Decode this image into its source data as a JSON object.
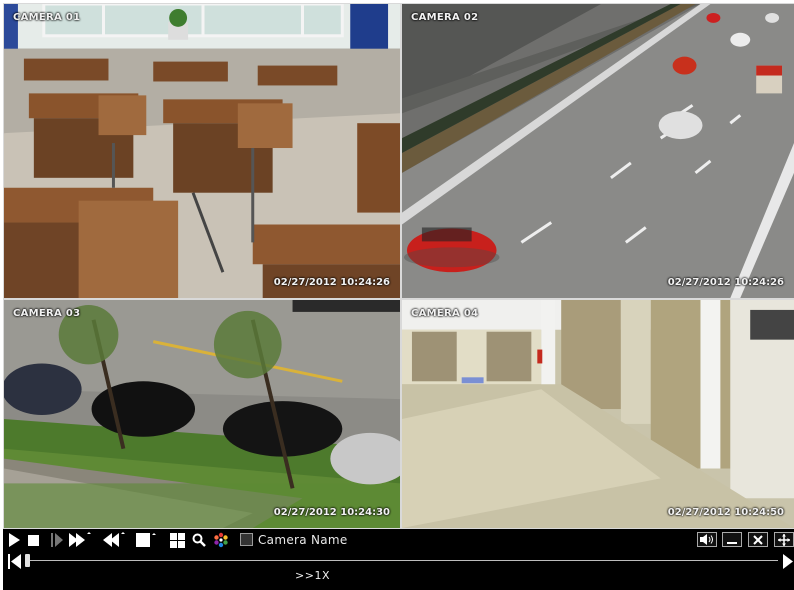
{
  "cameras": [
    {
      "label": "CAMERA 01",
      "timestamp": "02/27/2012 10:24:26",
      "scene": "classroom"
    },
    {
      "label": "CAMERA 02",
      "timestamp": "02/27/2012 10:24:26",
      "scene": "highway"
    },
    {
      "label": "CAMERA 03",
      "timestamp": "02/27/2012 10:24:30",
      "scene": "parking-street"
    },
    {
      "label": "CAMERA 04",
      "timestamp": "02/27/2012 10:24:50",
      "scene": "corridor"
    }
  ],
  "toolbar": {
    "camera_name_label": "Camera Name",
    "icons": [
      "play-icon",
      "stop-icon",
      "step-icon",
      "fast-forward-icon",
      "rewind-icon",
      "single-view-icon",
      "quad-view-icon",
      "zoom-icon",
      "color-icon",
      "volume-icon",
      "minimize-icon",
      "close-icon",
      "move-icon"
    ]
  },
  "playback": {
    "speed": ">>1X",
    "progress": 0.0
  },
  "colors": {
    "toolbar_bg": "#000000",
    "label_text": "#f2f2f2"
  }
}
